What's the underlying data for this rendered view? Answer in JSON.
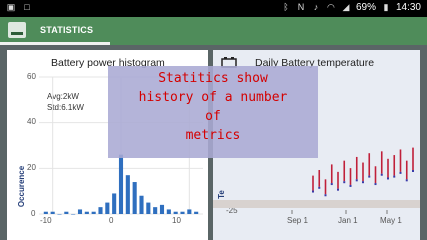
{
  "status_bar": {
    "battery": "69%",
    "time": "14:30",
    "icons": [
      "image-icon",
      "square-icon",
      "bluetooth-icon",
      "nfc-icon",
      "mute-icon",
      "wifi-icon",
      "signal-icon",
      "battery-icon"
    ]
  },
  "app_bar": {
    "title": "STATISTICS"
  },
  "histogram_card": {
    "title": "Battery power histogram",
    "avg": "Avg:2kW",
    "std": "Std:6.1kW",
    "y_label": "Occurence",
    "y_ticks": [
      "60",
      "40",
      "20",
      "0"
    ],
    "x_ticks": [
      "-10",
      "0",
      "10"
    ]
  },
  "temperature_card": {
    "title": "Daily Battery temperature",
    "y_label_partial": "Te",
    "y_ticks": [
      "-25"
    ],
    "x_ticks": [
      "Sep 1",
      "Jan 1",
      "May 1"
    ]
  },
  "overlay": {
    "text": "Statitics show\nhistory of a number\nof\nmetrics"
  },
  "colors": {
    "app_bar": "#4f8c5a",
    "histogram_bar": "#2f6fbf",
    "overlay_text": "#d40000",
    "overlay_bg": "#aaaad4",
    "temp_high": "#c0203a",
    "temp_low": "#3a3aa8"
  },
  "chart_data": [
    {
      "type": "bar",
      "title": "Battery power histogram",
      "ylabel": "Occurence",
      "xlabel": "",
      "ylim": [
        0,
        60
      ],
      "xlim": [
        -12,
        12
      ],
      "x": [
        -11,
        -10,
        -9,
        -8,
        -7,
        -6,
        -5,
        -4,
        -3,
        -2,
        -1,
        0,
        1,
        2,
        3,
        4,
        5,
        6,
        7,
        8,
        9,
        10,
        11
      ],
      "values": [
        1,
        1,
        0,
        1,
        0,
        2,
        1,
        1,
        3,
        5,
        9,
        26,
        17,
        14,
        8,
        5,
        3,
        4,
        2,
        1,
        1,
        2,
        1
      ]
    },
    {
      "type": "line",
      "title": "Daily Battery temperature",
      "ylabel": "Te",
      "x_ticks": [
        "Sep 1",
        "Jan 1",
        "May 1"
      ],
      "series": [
        {
          "values": [
            12,
            15,
            10,
            18,
            14,
            20,
            16,
            22,
            19,
            24,
            17,
            25,
            21,
            23,
            26,
            20,
            27
          ]
        },
        {
          "values": [
            4,
            6,
            2,
            8,
            5,
            9,
            7,
            10,
            9,
            12,
            8,
            13,
            11,
            12,
            14,
            10,
            15
          ]
        }
      ]
    }
  ]
}
